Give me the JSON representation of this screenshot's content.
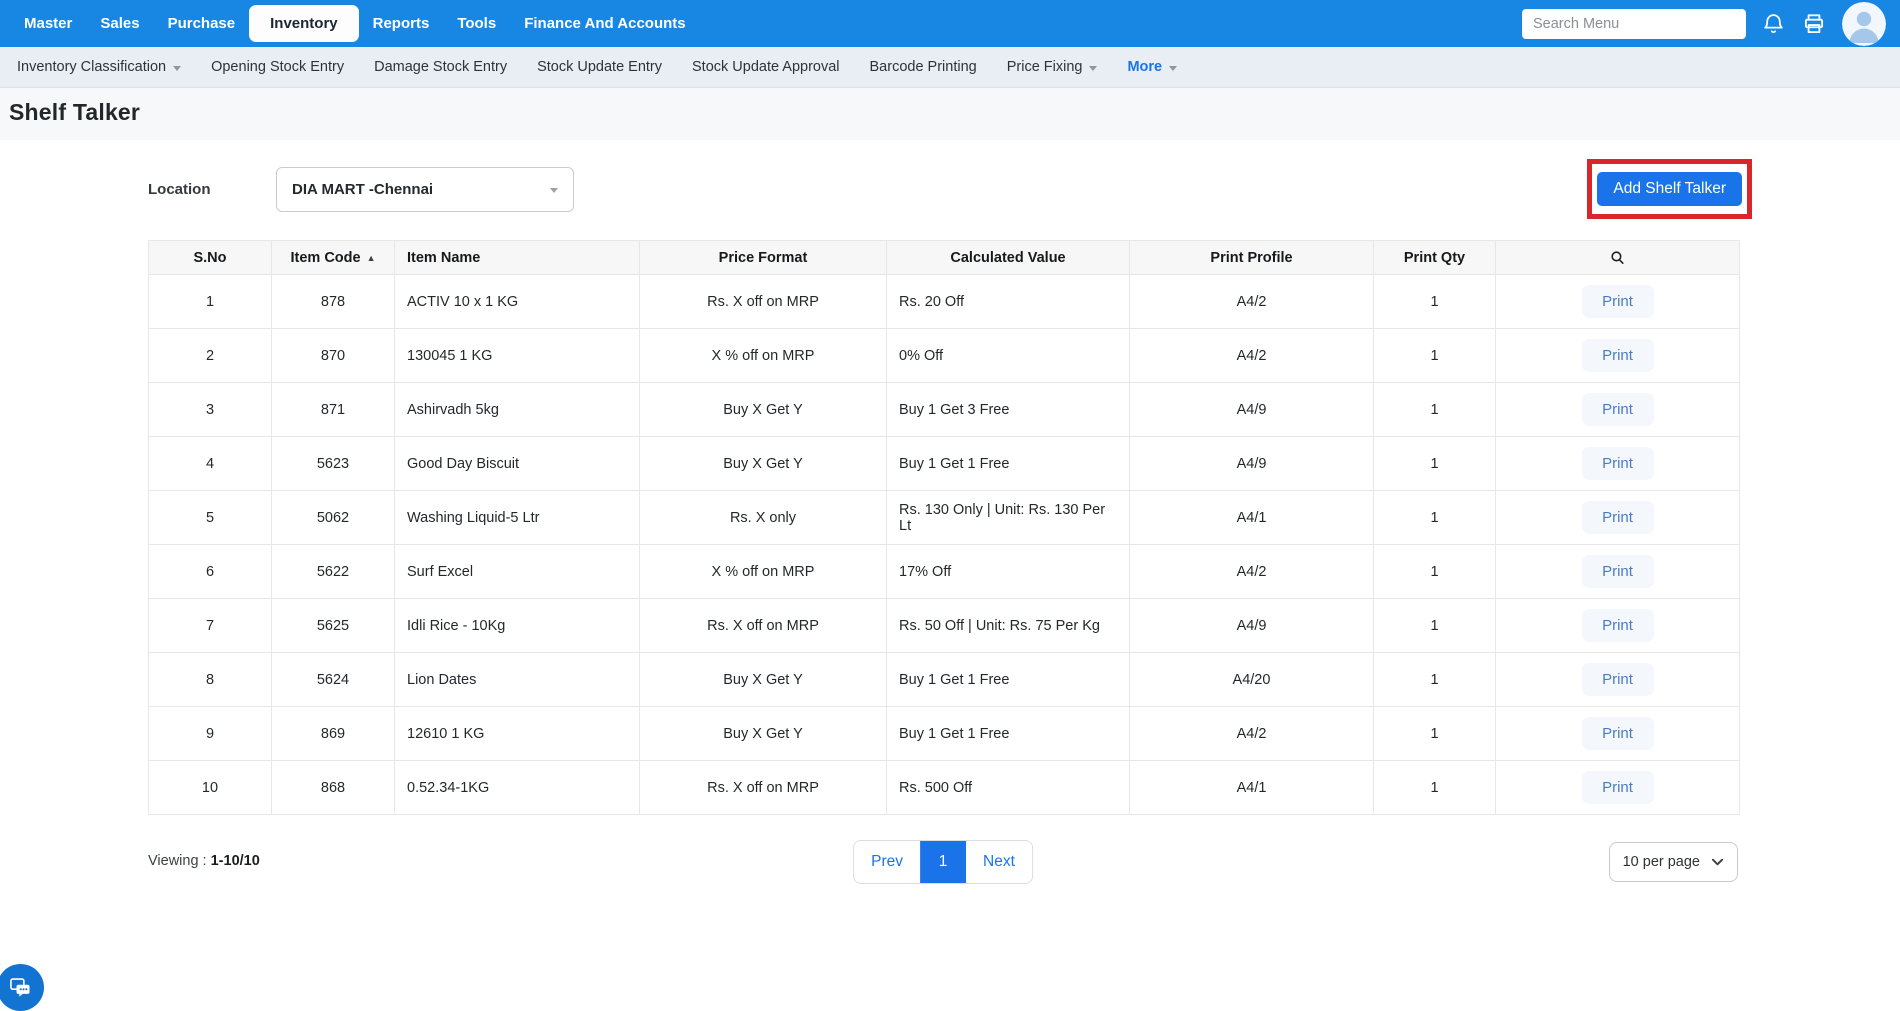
{
  "topnav": {
    "items": [
      {
        "label": "Master"
      },
      {
        "label": "Sales"
      },
      {
        "label": "Purchase"
      },
      {
        "label": "Inventory"
      },
      {
        "label": "Reports"
      },
      {
        "label": "Tools"
      },
      {
        "label": "Finance And Accounts"
      }
    ],
    "active": "Inventory",
    "search_placeholder": "Search Menu",
    "icons": [
      "bell-icon",
      "printer-icon",
      "avatar"
    ]
  },
  "subnav": {
    "items": [
      {
        "label": "Inventory Classification",
        "dropdown": true
      },
      {
        "label": "Opening Stock Entry"
      },
      {
        "label": "Damage Stock Entry"
      },
      {
        "label": "Stock Update Entry"
      },
      {
        "label": "Stock Update Approval"
      },
      {
        "label": "Barcode Printing"
      },
      {
        "label": "Price Fixing",
        "dropdown": true
      },
      {
        "label": "More",
        "dropdown": true,
        "active": true
      }
    ]
  },
  "page": {
    "title": "Shelf Talker"
  },
  "toolbar": {
    "location_label": "Location",
    "location_value": "DIA MART -Chennai",
    "add_button_label": "Add Shelf Talker"
  },
  "table": {
    "headers": [
      "S.No",
      "Item Code",
      "Item Name",
      "Price Format",
      "Calculated Value",
      "Print Profile",
      "Print Qty"
    ],
    "sort_column": "Item Code",
    "action_header_icon": "search-icon",
    "print_label": "Print",
    "rows": [
      {
        "sno": "1",
        "code": "878",
        "name": "ACTIV 10 x 1 KG",
        "format": "Rs. X off on MRP",
        "value": "Rs. 20 Off",
        "profile": "A4/2",
        "qty": "1"
      },
      {
        "sno": "2",
        "code": "870",
        "name": "130045 1 KG",
        "format": "X % off on MRP",
        "value": "0% Off",
        "profile": "A4/2",
        "qty": "1"
      },
      {
        "sno": "3",
        "code": "871",
        "name": "Ashirvadh 5kg",
        "format": "Buy X Get Y",
        "value": "Buy 1 Get 3 Free",
        "profile": "A4/9",
        "qty": "1"
      },
      {
        "sno": "4",
        "code": "5623",
        "name": "Good Day Biscuit",
        "format": "Buy X Get Y",
        "value": "Buy 1 Get 1 Free",
        "profile": "A4/9",
        "qty": "1"
      },
      {
        "sno": "5",
        "code": "5062",
        "name": "Washing Liquid-5 Ltr",
        "format": "Rs. X only",
        "value": "Rs. 130 Only | Unit: Rs. 130 Per Lt",
        "profile": "A4/1",
        "qty": "1"
      },
      {
        "sno": "6",
        "code": "5622",
        "name": "Surf Excel",
        "format": "X % off on MRP",
        "value": "17% Off",
        "profile": "A4/2",
        "qty": "1"
      },
      {
        "sno": "7",
        "code": "5625",
        "name": "Idli Rice - 10Kg",
        "format": "Rs. X off on MRP",
        "value": "Rs. 50 Off | Unit: Rs. 75 Per Kg",
        "profile": "A4/9",
        "qty": "1"
      },
      {
        "sno": "8",
        "code": "5624",
        "name": "Lion Dates",
        "format": "Buy X Get Y",
        "value": "Buy 1 Get 1 Free",
        "profile": "A4/20",
        "qty": "1"
      },
      {
        "sno": "9",
        "code": "869",
        "name": "12610 1 KG",
        "format": "Buy X Get Y",
        "value": "Buy 1 Get 1 Free",
        "profile": "A4/2",
        "qty": "1"
      },
      {
        "sno": "10",
        "code": "868",
        "name": "0.52.34-1KG",
        "format": "Rs. X off on MRP",
        "value": "Rs. 500 Off",
        "profile": "A4/1",
        "qty": "1"
      }
    ]
  },
  "footer": {
    "viewing_label": "Viewing : ",
    "viewing_value": "1-10/10",
    "prev_label": "Prev",
    "current_page": "1",
    "next_label": "Next",
    "per_page_value": "10 per page"
  },
  "colors": {
    "topbar_blue": "#1787e3",
    "accent_blue": "#1a73e8",
    "annotation_red": "#d8262a",
    "subnav_bg": "#e9eef4"
  }
}
